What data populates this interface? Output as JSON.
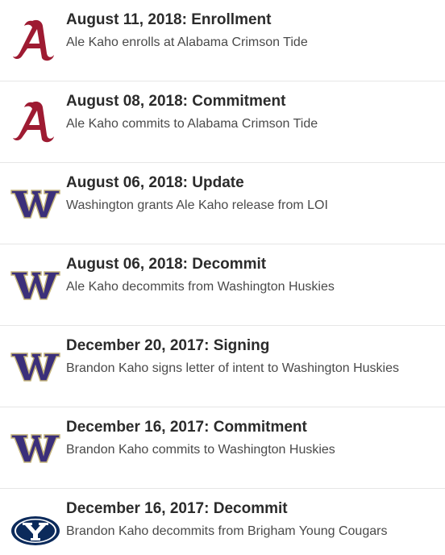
{
  "events": [
    {
      "title": "August 11, 2018: Enrollment",
      "description": "Ale Kaho enrolls at Alabama Crimson Tide",
      "logo": "alabama-a-logo"
    },
    {
      "title": "August 08, 2018: Commitment",
      "description": "Ale Kaho commits to Alabama Crimson Tide",
      "logo": "alabama-a-logo"
    },
    {
      "title": "August 06, 2018: Update",
      "description": "Washington grants Ale Kaho release from LOI",
      "logo": "washington-w-logo"
    },
    {
      "title": "August 06, 2018: Decommit",
      "description": "Ale Kaho decommits from Washington Huskies",
      "logo": "washington-w-logo"
    },
    {
      "title": "December 20, 2017: Signing",
      "description": "Brandon Kaho signs letter of intent to Washington Huskies",
      "logo": "washington-w-logo"
    },
    {
      "title": "December 16, 2017: Commitment",
      "description": "Brandon Kaho commits to Washington Huskies",
      "logo": "washington-w-logo"
    },
    {
      "title": "December 16, 2017: Decommit",
      "description": "Brandon Kaho decommits from Brigham Young Cougars",
      "logo": "byu-y-logo"
    }
  ],
  "colors": {
    "alabama_crimson": "#9e1b32",
    "washington_purple": "#3b2f7a",
    "washington_gold": "#c4b47a",
    "byu_navy": "#0b2a5b"
  }
}
